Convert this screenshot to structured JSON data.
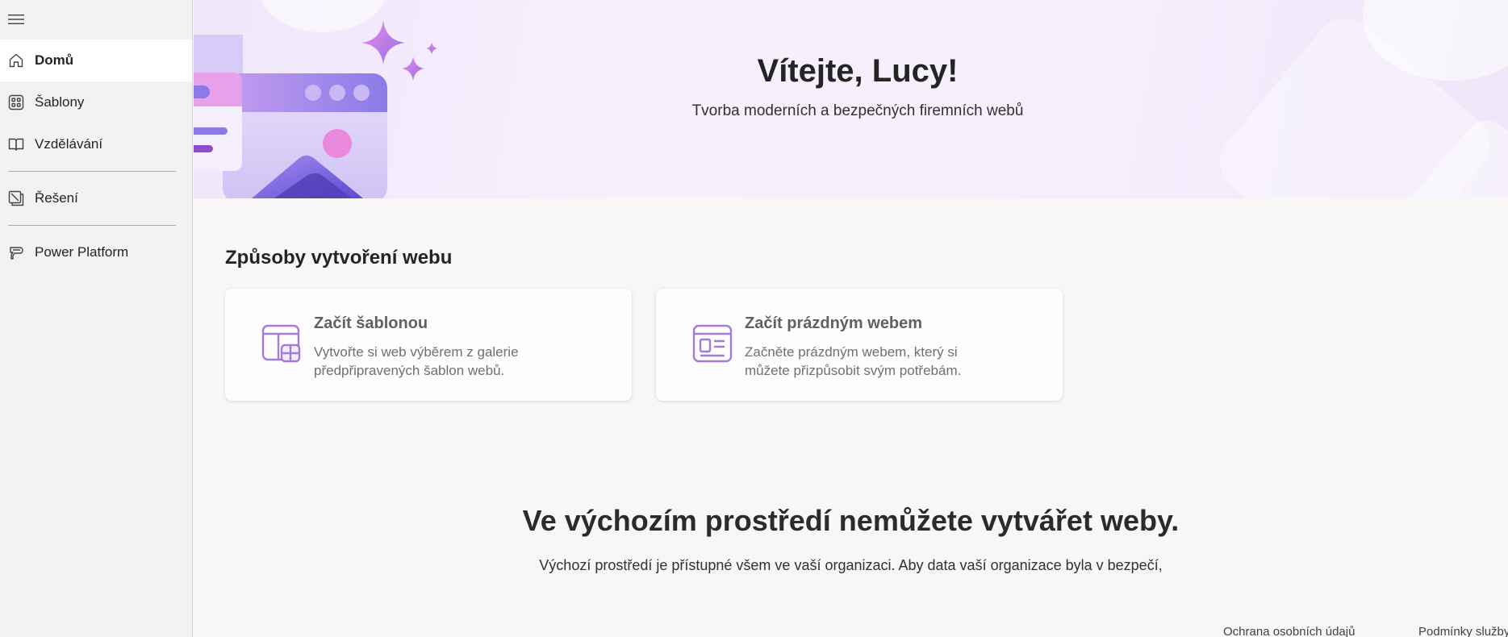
{
  "sidebar": {
    "menu_icon": "hamburger-menu-icon",
    "items": [
      {
        "label": "Domů",
        "icon": "home-icon",
        "active": true
      },
      {
        "label": "Šablony",
        "icon": "templates-grid-icon",
        "active": false
      },
      {
        "label": "Vzdělávání",
        "icon": "book-icon",
        "active": false
      },
      {
        "label": "Řešení",
        "icon": "solutions-icon",
        "active": false
      },
      {
        "label": "Power Platform",
        "icon": "power-platform-icon",
        "active": false
      }
    ]
  },
  "hero": {
    "title": "Vítejte, Lucy!",
    "subtitle": "Tvorba moderních a bezpečných firemních webů"
  },
  "create": {
    "section_title": "Způsoby vytvoření webu",
    "cards": [
      {
        "title": "Začít šablonou",
        "description": "Vytvořte si web výběrem z galerie předpřipravených šablon webů.",
        "icon": "template-layout-icon"
      },
      {
        "title": "Začít prázdným webem",
        "description": "Začněte prázdným webem, který si můžete přizpůsobit svým potřebám.",
        "icon": "blank-site-icon"
      }
    ]
  },
  "notice": {
    "title": "Ve výchozím prostředí nemůžete vytvářet weby.",
    "text": "Výchozí prostředí je přístupné všem ve vaší organizaci. Aby data vaší organizace byla v bezpečí,"
  },
  "footer": {
    "privacy": "Ochrana osobních údajů",
    "terms": "Podmínky služby"
  },
  "colors": {
    "accent_purple": "#8764b8",
    "sidebar_bg": "#f3f2f1",
    "content_bg": "#f8f7f6"
  }
}
